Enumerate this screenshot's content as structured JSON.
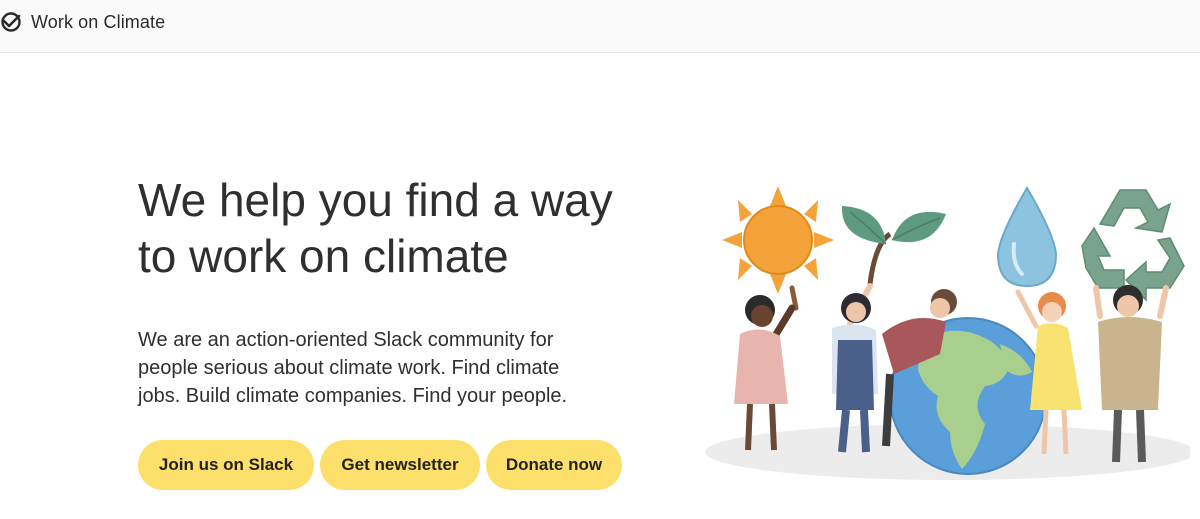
{
  "header": {
    "brand_name": "Work on Climate",
    "logo_icon": "work-on-climate-logo-icon"
  },
  "hero": {
    "title_line1": "We help you find a way",
    "title_line2": "to work on climate",
    "desc_line1": "We are an action-oriented Slack community for",
    "desc_line2": "people serious about climate work. Find climate",
    "desc_line3": "jobs. Build climate companies. Find your people."
  },
  "buttons": {
    "slack": "Join us on Slack",
    "newsletter": "Get newsletter",
    "donate": "Donate now"
  },
  "colors": {
    "button_bg": "#fde06b",
    "sun": "#f3a33a",
    "leaf": "#5e9a80",
    "water": "#8cc3df",
    "recycle": "#7aa38d",
    "ocean": "#5a9fd9",
    "land": "#a9cf8f"
  },
  "illustration": {
    "icons": [
      "sun-icon",
      "plant-icon",
      "water-drop-icon",
      "recycle-icon",
      "globe-icon",
      "people-group"
    ]
  }
}
